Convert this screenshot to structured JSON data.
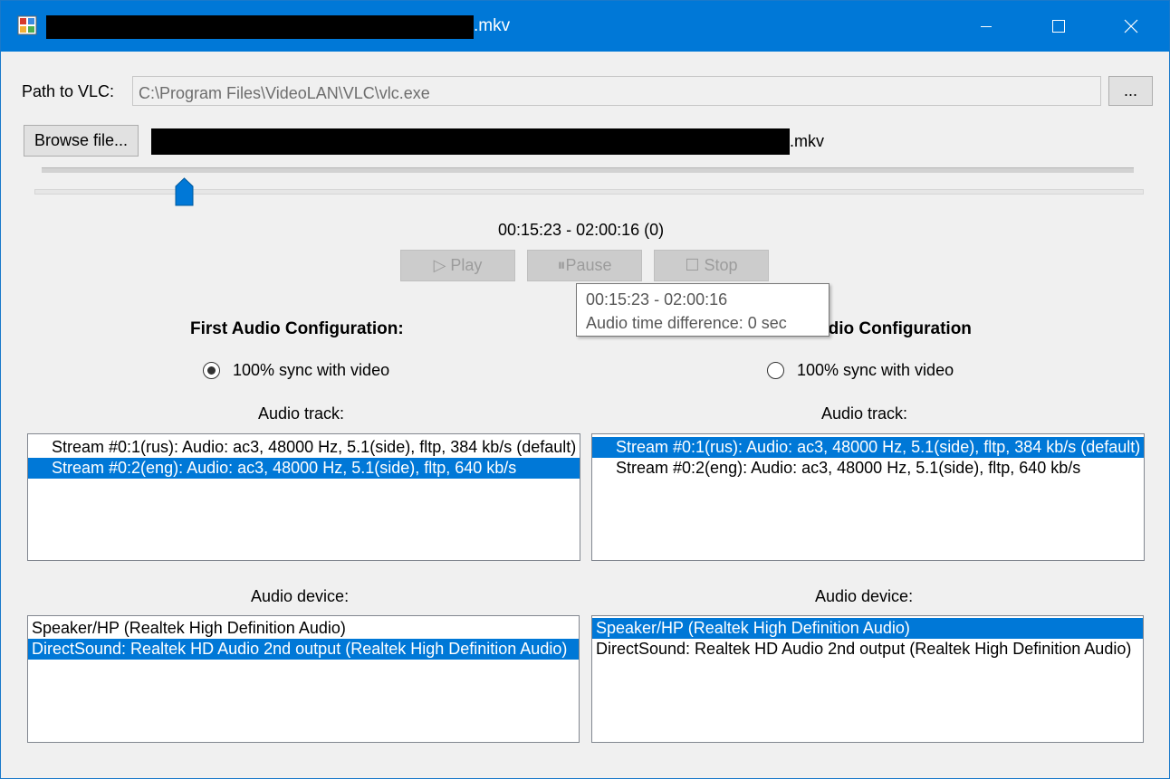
{
  "window": {
    "title_suffix": ".mkv",
    "minimize_label": "—",
    "maximize_label": "☐",
    "close_label": "✕"
  },
  "vlc": {
    "label": "Path to VLC:",
    "path": "C:\\Program Files\\VideoLAN\\VLC\\vlc.exe",
    "browse_label": "..."
  },
  "file": {
    "browse_label": "Browse file...",
    "name_suffix": ".mkv"
  },
  "player": {
    "position_fraction": 0.127,
    "time_text": "00:15:23 - 02:00:16 (0)",
    "play_label": "▷ Play",
    "pause_label": "⏸Pause",
    "stop_label": "☐ Stop"
  },
  "tooltip": {
    "line1": "00:15:23 - 02:00:16",
    "line2": "Audio time difference: 0 sec"
  },
  "left": {
    "heading": "First Audio Configuration:",
    "sync_label": "100% sync with video",
    "sync_checked": true,
    "track_label": "Audio track:",
    "tracks": [
      "Stream #0:1(rus): Audio: ac3, 48000 Hz, 5.1(side), fltp, 384 kb/s (default)",
      "Stream #0:2(eng): Audio: ac3, 48000 Hz, 5.1(side), fltp, 640 kb/s"
    ],
    "track_selected": 1,
    "device_label": "Audio device:",
    "devices": [
      "Speaker/HP (Realtek High Definition Audio)",
      "DirectSound: Realtek HD Audio 2nd output (Realtek High Definition Audio)"
    ],
    "device_selected": 1
  },
  "right": {
    "heading": "udio Configuration",
    "sync_label": "100% sync with video",
    "sync_checked": false,
    "track_label": "Audio track:",
    "tracks": [
      "Stream #0:1(rus): Audio: ac3, 48000 Hz, 5.1(side), fltp, 384 kb/s (default)",
      "Stream #0:2(eng): Audio: ac3, 48000 Hz, 5.1(side), fltp, 640 kb/s"
    ],
    "track_selected": 0,
    "device_label": "Audio device:",
    "devices": [
      "Speaker/HP (Realtek High Definition Audio)",
      "DirectSound: Realtek HD Audio 2nd output (Realtek High Definition Audio)"
    ],
    "device_selected": 0
  },
  "colors": {
    "titlebar": "#0078d7",
    "selection": "#0078d7",
    "thumb": "#0078d7"
  },
  "icons": [
    "app-icon",
    "minimize-icon",
    "maximize-icon",
    "close-icon",
    "slider-thumb-icon",
    "radio-icon"
  ]
}
